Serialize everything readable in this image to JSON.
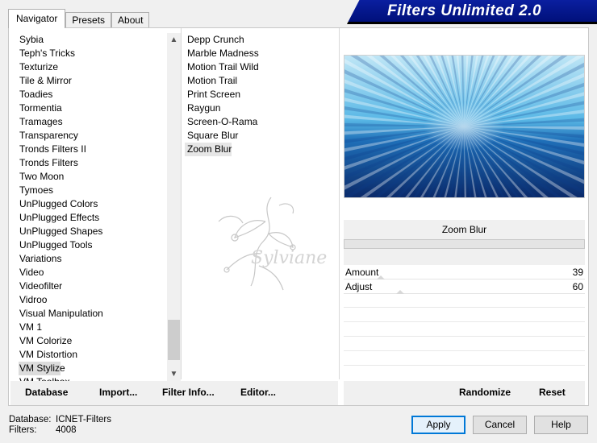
{
  "tabs": [
    {
      "label": "Navigator",
      "active": true
    },
    {
      "label": "Presets",
      "active": false
    },
    {
      "label": "About",
      "active": false
    }
  ],
  "banner": {
    "title": "Filters Unlimited 2.0"
  },
  "categories": {
    "items": [
      "Sybia",
      "Teph's Tricks",
      "Texturize",
      "Tile & Mirror",
      "Toadies",
      "Tormentia",
      "Tramages",
      "Transparency",
      "Tronds Filters II",
      "Tronds Filters",
      "Two Moon",
      "Tymoes",
      "UnPlugged Colors",
      "UnPlugged Effects",
      "UnPlugged Shapes",
      "UnPlugged Tools",
      "Variations",
      "Video",
      "Videofilter",
      "Vidroo",
      "Visual Manipulation",
      "VM 1",
      "VM Colorize",
      "VM Distortion",
      "VM Stylize",
      "VM Toolbox"
    ],
    "selected": "VM Stylize"
  },
  "filters": {
    "items": [
      "Depp Crunch",
      "Marble Madness",
      "Motion Trail Wild",
      "Motion Trail",
      "Print Screen",
      "Raygun",
      "Screen-O-Rama",
      "Square Blur",
      "Zoom Blur"
    ],
    "selected": "Zoom Blur"
  },
  "watermark": {
    "text": "Sylviane"
  },
  "filter_panel": {
    "name": "Zoom Blur",
    "params": [
      {
        "name": "Amount",
        "value": "39",
        "level": 39
      },
      {
        "name": "Adjust",
        "value": "60",
        "level": 60
      }
    ]
  },
  "toolbar": {
    "database": "Database",
    "import": "Import...",
    "filter_info": "Filter Info...",
    "editor": "Editor...",
    "randomize": "Randomize",
    "reset": "Reset"
  },
  "footer": {
    "database_label": "Database:",
    "database_value": "ICNET-Filters",
    "filters_label": "Filters:",
    "filters_value": "4008"
  },
  "buttons": {
    "apply": "Apply",
    "cancel": "Cancel",
    "help": "Help"
  },
  "colors": {
    "banner": "#0a1fa0",
    "accent": "#0078d7"
  }
}
